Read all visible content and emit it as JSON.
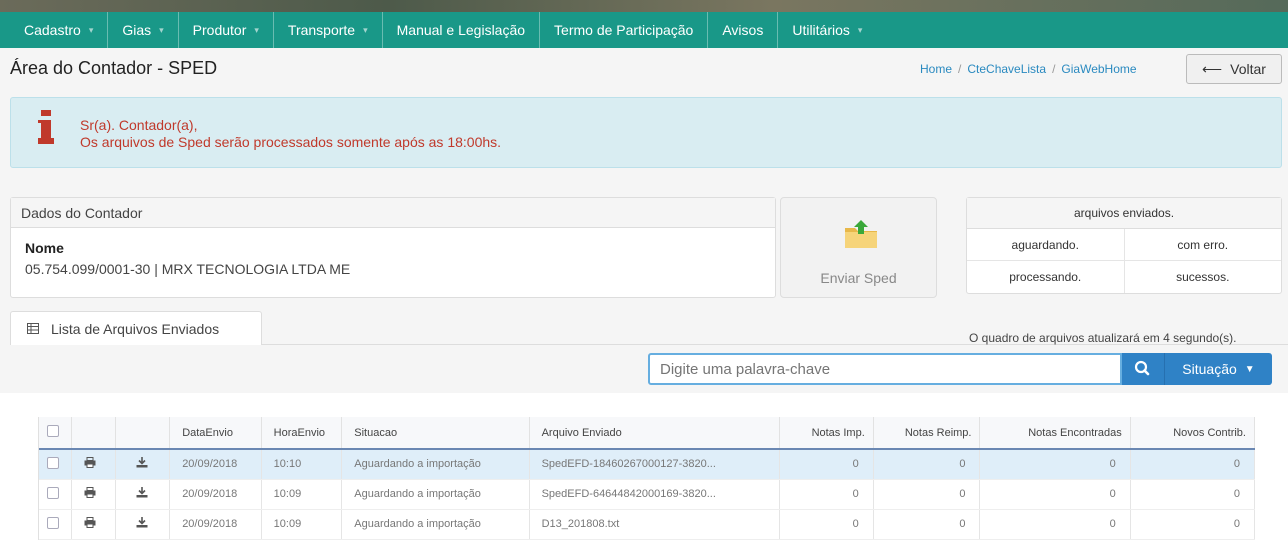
{
  "nav": {
    "items": [
      {
        "label": "Cadastro",
        "dropdown": true
      },
      {
        "label": "Gias",
        "dropdown": true
      },
      {
        "label": "Produtor",
        "dropdown": true
      },
      {
        "label": "Transporte",
        "dropdown": true
      },
      {
        "label": "Manual e Legislação",
        "dropdown": false
      },
      {
        "label": "Termo de Participação",
        "dropdown": false
      },
      {
        "label": "Avisos",
        "dropdown": false
      },
      {
        "label": "Utilitários",
        "dropdown": true
      }
    ]
  },
  "header": {
    "title": "Área do Contador - SPED",
    "breadcrumb": [
      "Home",
      "CteChaveLista",
      "GiaWebHome"
    ],
    "back_label": "Voltar"
  },
  "alert": {
    "line1": "Sr(a). Contador(a),",
    "line2": "Os arquivos de Sped serão processados somente após as 18:00hs."
  },
  "dados": {
    "header": "Dados do Contador",
    "name_label": "Nome",
    "name_value": "05.754.099/0001-30 | MRX TECNOLOGIA LTDA ME"
  },
  "enviar": {
    "label": "Enviar Sped",
    "icon": "folder-upload-icon"
  },
  "stats": {
    "header": "arquivos enviados.",
    "aguardando": "aguardando.",
    "com_erro": "com erro.",
    "processando": "processando.",
    "sucessos": "sucessos."
  },
  "tab": {
    "label": "Lista de Arquivos Enviados",
    "icon": "table-icon"
  },
  "refresh_text": "O quadro de arquivos atualizará em 4 segundo(s).",
  "search": {
    "placeholder": "Digite uma palavra-chave",
    "situacao_label": "Situação"
  },
  "table": {
    "columns": [
      "DataEnvio",
      "HoraEnvio",
      "Situacao",
      "Arquivo Enviado",
      "Notas Imp.",
      "Notas Reimp.",
      "Notas Encontradas",
      "Novos Contrib."
    ],
    "rows": [
      {
        "data": "20/09/2018",
        "hora": "10:10",
        "situacao": "Aguardando a importação",
        "arquivo": "SpedEFD-18460267000127-3820...",
        "imp": "0",
        "reimp": "0",
        "encontradas": "0",
        "novos": "0",
        "selected": true
      },
      {
        "data": "20/09/2018",
        "hora": "10:09",
        "situacao": "Aguardando a importação",
        "arquivo": "SpedEFD-64644842000169-3820...",
        "imp": "0",
        "reimp": "0",
        "encontradas": "0",
        "novos": "0",
        "selected": false
      },
      {
        "data": "20/09/2018",
        "hora": "10:09",
        "situacao": "Aguardando a importação",
        "arquivo": "D13_201808.txt",
        "imp": "0",
        "reimp": "0",
        "encontradas": "0",
        "novos": "0",
        "selected": false
      }
    ]
  },
  "colors": {
    "navbar": "#199888",
    "alert_bg": "#d9edf2",
    "alert_text": "#c0392b",
    "primary_button": "#2f82c6",
    "link": "#2a8ac0"
  }
}
